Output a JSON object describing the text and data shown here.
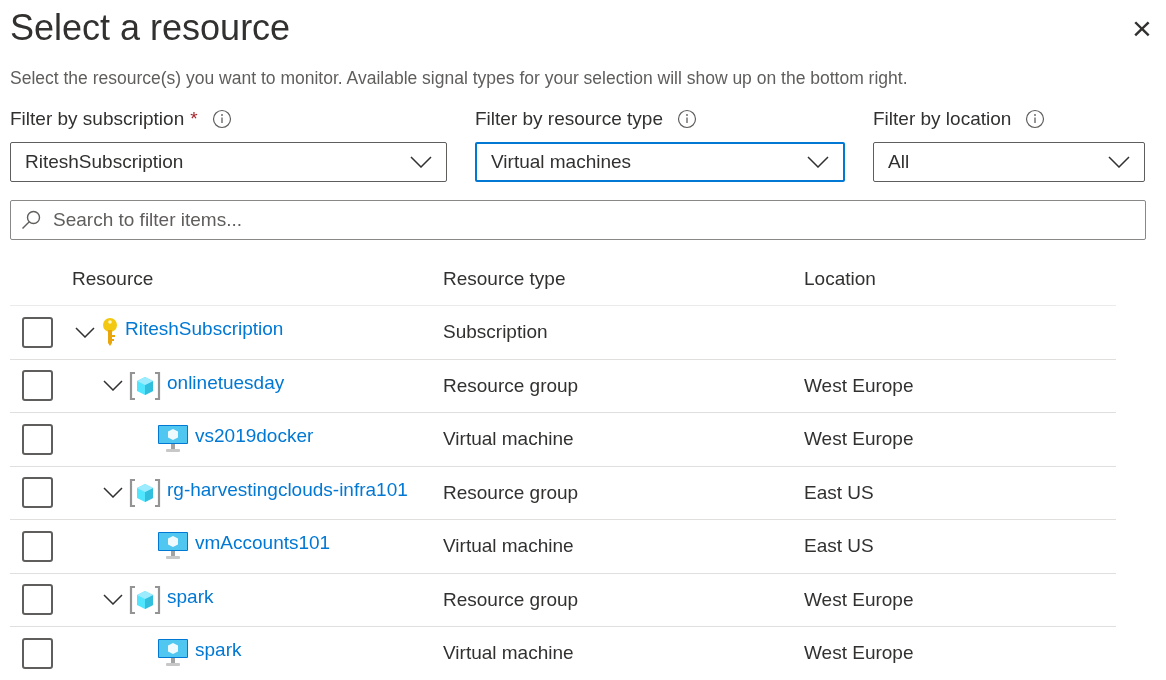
{
  "title": "Select a resource",
  "close": "×",
  "description": "Select the resource(s) you want to monitor. Available signal types for your selection will show up on the bottom right.",
  "filters": [
    {
      "label": "Filter by subscription",
      "required": true,
      "required_mark": "*",
      "value": "RiteshSubscription",
      "focused": false
    },
    {
      "label": "Filter by resource type",
      "required": false,
      "value": "Virtual machines",
      "focused": true
    },
    {
      "label": "Filter by location",
      "required": false,
      "value": "All",
      "focused": false
    }
  ],
  "search": {
    "placeholder": "Search to filter items..."
  },
  "table": {
    "columns": [
      "Resource",
      "Resource type",
      "Location"
    ],
    "rows": [
      {
        "kind": "subscription",
        "name": "RiteshSubscription",
        "type": "Subscription",
        "checked": false,
        "expanded": true,
        "children": [
          {
            "kind": "resource-group",
            "name": "onlinetuesday",
            "type": "Resource group",
            "location": "West Europe",
            "checked": false,
            "expanded": true,
            "children": [
              {
                "kind": "virtual-machine",
                "name": "vs2019docker",
                "type": "Virtual machine",
                "location": "West Europe",
                "checked": false
              }
            ]
          },
          {
            "kind": "resource-group",
            "name": "rg-harvestingclouds-infra101",
            "type": "Resource group",
            "location": "East US",
            "checked": false,
            "expanded": true,
            "children": [
              {
                "kind": "virtual-machine",
                "name": "vmAccounts101",
                "type": "Virtual machine",
                "location": "East US",
                "checked": false
              }
            ]
          },
          {
            "kind": "resource-group",
            "name": "spark",
            "type": "Resource group",
            "location": "West Europe",
            "checked": false,
            "expanded": true,
            "children": [
              {
                "kind": "virtual-machine",
                "name": "spark",
                "type": "Virtual machine",
                "location": "West Europe",
                "checked": false
              }
            ]
          }
        ]
      }
    ]
  }
}
